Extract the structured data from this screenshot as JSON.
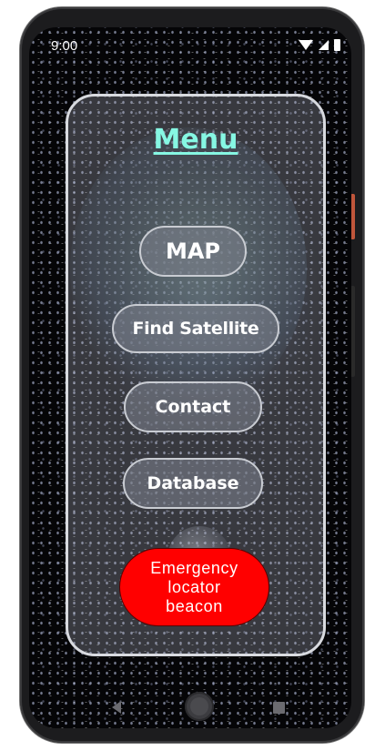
{
  "status_bar": {
    "time": "9:00",
    "icons": [
      "wifi-icon",
      "signal-icon",
      "battery-icon"
    ]
  },
  "menu": {
    "title": "Menu",
    "buttons": {
      "map": "MAP",
      "find_satellite": "Find Satellite",
      "contact": "Contact",
      "database": "Database",
      "emergency": "Emergency\nlocator\nbeacon"
    }
  },
  "nav_bar": {
    "icons": [
      "back-icon",
      "home-icon",
      "recents-icon"
    ]
  },
  "colors": {
    "title": "#86f7e3",
    "emergency_button": "#ff0000",
    "menu_button_fill": "rgba(120,125,135,0.62)",
    "panel_border": "#d8dadf"
  }
}
